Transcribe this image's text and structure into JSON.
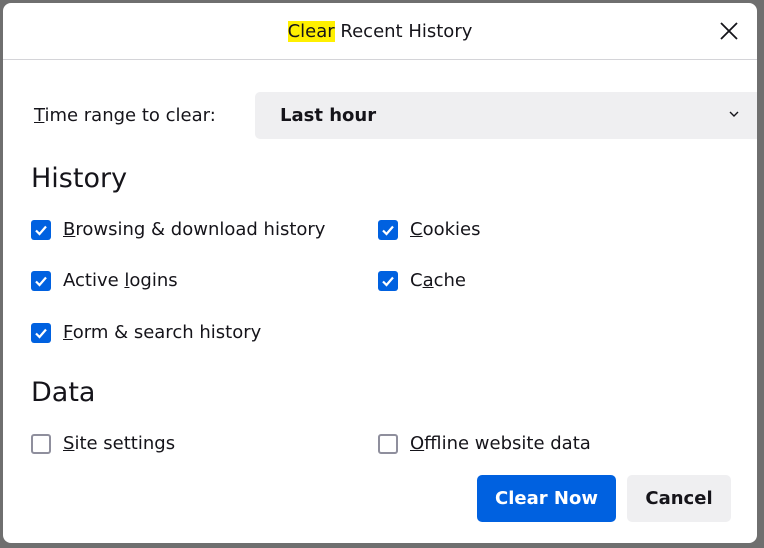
{
  "dialog": {
    "title_highlight": "Clear",
    "title_rest": " Recent History",
    "close_icon": "close-icon"
  },
  "time_range": {
    "label_key": "T",
    "label_rest": "ime range to clear:",
    "selected": "Last hour"
  },
  "history": {
    "heading": "History",
    "items": [
      {
        "pre": "",
        "key": "B",
        "post": "rowsing & download history",
        "checked": true
      },
      {
        "pre": "",
        "key": "C",
        "post": "ookies",
        "checked": true
      },
      {
        "pre": "Active ",
        "key": "l",
        "post": "ogins",
        "checked": true
      },
      {
        "pre": "C",
        "key": "a",
        "post": "che",
        "checked": true
      },
      {
        "pre": "",
        "key": "F",
        "post": "orm & search history",
        "checked": true
      }
    ]
  },
  "data_section": {
    "heading": "Data",
    "items": [
      {
        "pre": "",
        "key": "S",
        "post": "ite settings",
        "checked": false
      },
      {
        "pre": "",
        "key": "O",
        "post": "ffline website data",
        "checked": false
      }
    ]
  },
  "buttons": {
    "clear_now": "Clear Now",
    "cancel": "Cancel"
  },
  "colors": {
    "accent": "#0061e0",
    "highlight": "#fff000"
  }
}
